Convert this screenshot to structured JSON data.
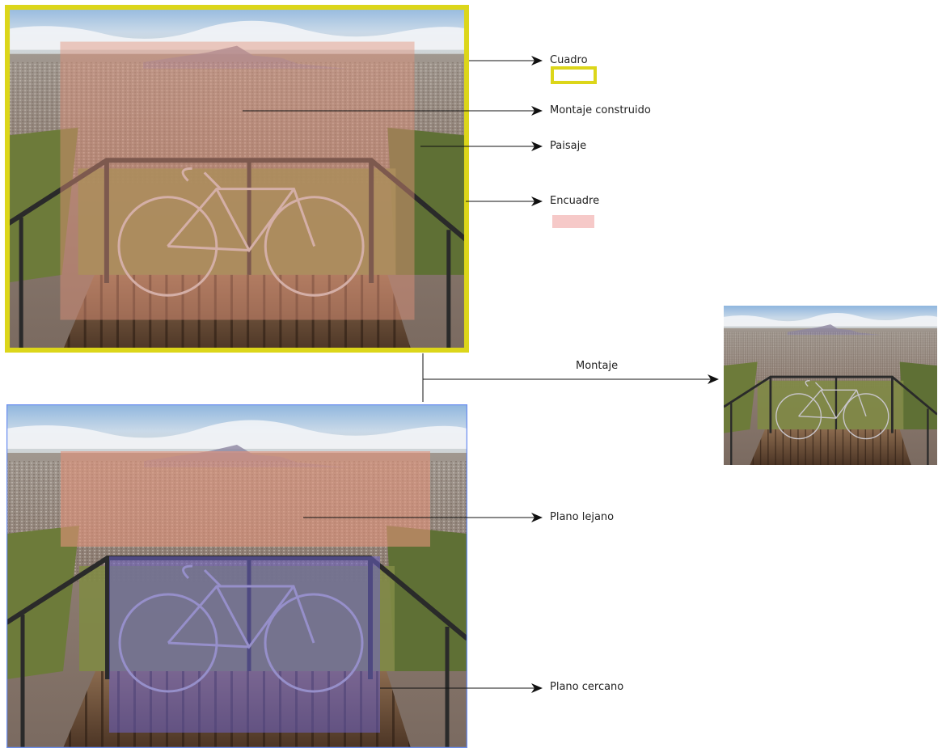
{
  "labels": {
    "cuadro": "Cuadro",
    "montaje_construido": "Montaje construido",
    "paisaje": "Paisaje",
    "encuadre": "Encuadre",
    "montaje": "Montaje",
    "plano_lejano": "Plano lejano",
    "plano_cercano": "Plano cercano"
  },
  "colors": {
    "frame_yellow": "#dcd61a",
    "encuadre_pink": "#f6c9c8",
    "far_plane_overlay": "#e3927a",
    "near_plane_overlay": "#6b63c9",
    "bottom_photo_border": "#6c8ff0",
    "sky": "#a9c6e3",
    "city": "#8f7e72",
    "deck": "#6a4a33",
    "vegetation": "#6d7b3a",
    "rail": "#2a2a2a"
  }
}
